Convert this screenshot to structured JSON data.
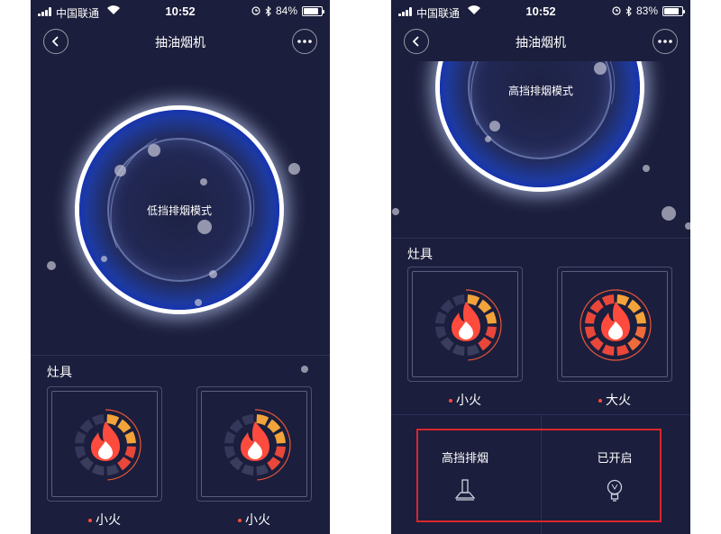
{
  "screens": [
    {
      "status": {
        "carrier": "中国联通",
        "time": "10:52",
        "battery": "84%",
        "battery_level": 0.84
      },
      "nav": {
        "title": "抽油烟机"
      },
      "fan": {
        "mode": "低挡排烟模式"
      },
      "section": {
        "label": "灶具"
      },
      "burners": [
        {
          "label": "小火"
        },
        {
          "label": "小火"
        }
      ]
    },
    {
      "status": {
        "carrier": "中国联通",
        "time": "10:52",
        "battery": "83%",
        "battery_level": 0.83
      },
      "nav": {
        "title": "抽油烟机"
      },
      "fan": {
        "mode": "高挡排烟模式"
      },
      "section": {
        "label": "灶具"
      },
      "burners": [
        {
          "label": "小火"
        },
        {
          "label": "大火"
        }
      ],
      "controls": [
        {
          "label": "高挡排烟",
          "icon": "range-hood-icon"
        },
        {
          "label": "已开启",
          "icon": "light-bulb-icon"
        }
      ]
    }
  ],
  "colors": {
    "background": "#1b1e3c",
    "accent_red": "#ff4b3d",
    "highlight": "#d8262b",
    "ring_blue": "#1532b8"
  }
}
